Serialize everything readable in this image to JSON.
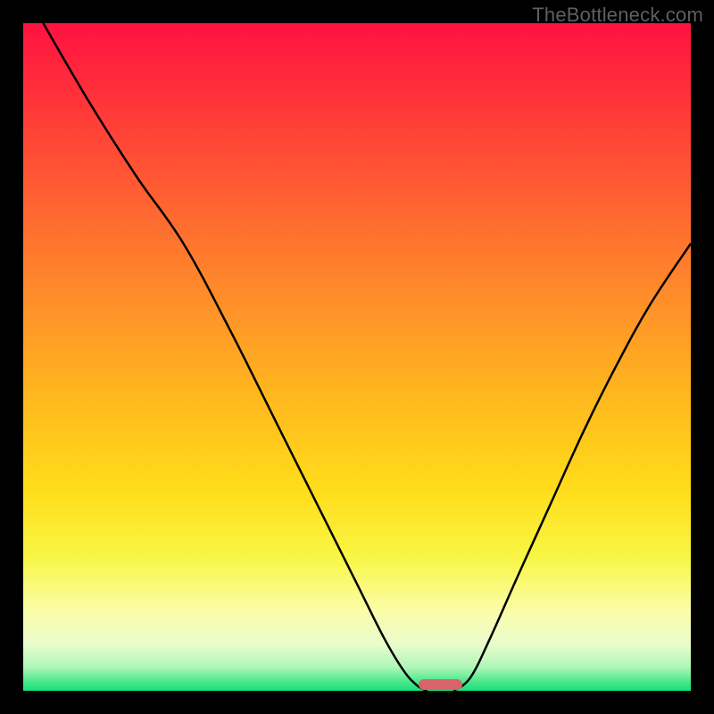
{
  "watermark": {
    "text": "TheBottleneck.com"
  },
  "chart_data": {
    "type": "line",
    "title": "",
    "xlabel": "",
    "ylabel": "",
    "xlim": [
      0,
      100
    ],
    "ylim": [
      0,
      100
    ],
    "grid": false,
    "legend": false,
    "series": [
      {
        "name": "left-branch",
        "x": [
          3,
          10,
          17,
          24,
          31,
          38,
          44.5,
          50,
          54,
          57,
          59,
          60.5
        ],
        "y": [
          100,
          88,
          77,
          67,
          54,
          40,
          27,
          16,
          8,
          3,
          0.8,
          0
        ]
      },
      {
        "name": "right-branch",
        "x": [
          64.5,
          67,
          70,
          74,
          79,
          84,
          89,
          94,
          100
        ],
        "y": [
          0,
          2,
          8,
          17,
          28,
          39,
          49,
          58,
          67
        ]
      }
    ],
    "marker": {
      "name": "optimal-range",
      "x_center": 62.5,
      "width_pct": 6.5,
      "y": 0,
      "color": "#d9636b"
    },
    "background_gradient": {
      "stops": [
        {
          "offset": 0.0,
          "color": "#ff1240"
        },
        {
          "offset": 0.1,
          "color": "#ff2f3a"
        },
        {
          "offset": 0.24,
          "color": "#ff5a33"
        },
        {
          "offset": 0.4,
          "color": "#ff8a2a"
        },
        {
          "offset": 0.55,
          "color": "#ffb51f"
        },
        {
          "offset": 0.7,
          "color": "#ffdd1a"
        },
        {
          "offset": 0.8,
          "color": "#f8f645"
        },
        {
          "offset": 0.88,
          "color": "#fbfda8"
        },
        {
          "offset": 0.93,
          "color": "#eafccd"
        },
        {
          "offset": 0.965,
          "color": "#aef6b7"
        },
        {
          "offset": 0.985,
          "color": "#4fe98e"
        },
        {
          "offset": 1.0,
          "color": "#16df7c"
        }
      ]
    }
  }
}
